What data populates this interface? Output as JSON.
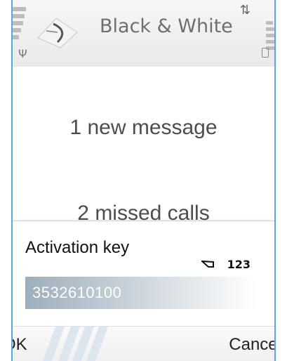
{
  "header": {
    "title": "Black & White",
    "app_icon": "app-logo-icon",
    "signal_icon": "signal-bars-icon",
    "antenna_icon": "antenna-icon",
    "battery_icon": "battery-icon",
    "connectivity_icon": "data-arrows-icon"
  },
  "notifications": {
    "messages": "1 new message",
    "calls": "2 missed calls"
  },
  "dialog": {
    "title": "Activation key",
    "input_mode": "123",
    "input_mode_icon": "pencil-icon",
    "input_value": "3532610100"
  },
  "softkeys": {
    "left": "OK",
    "right": "Cancel"
  },
  "colors": {
    "border_accent": "#5aa9d6",
    "input_fill": "#9daebc"
  }
}
